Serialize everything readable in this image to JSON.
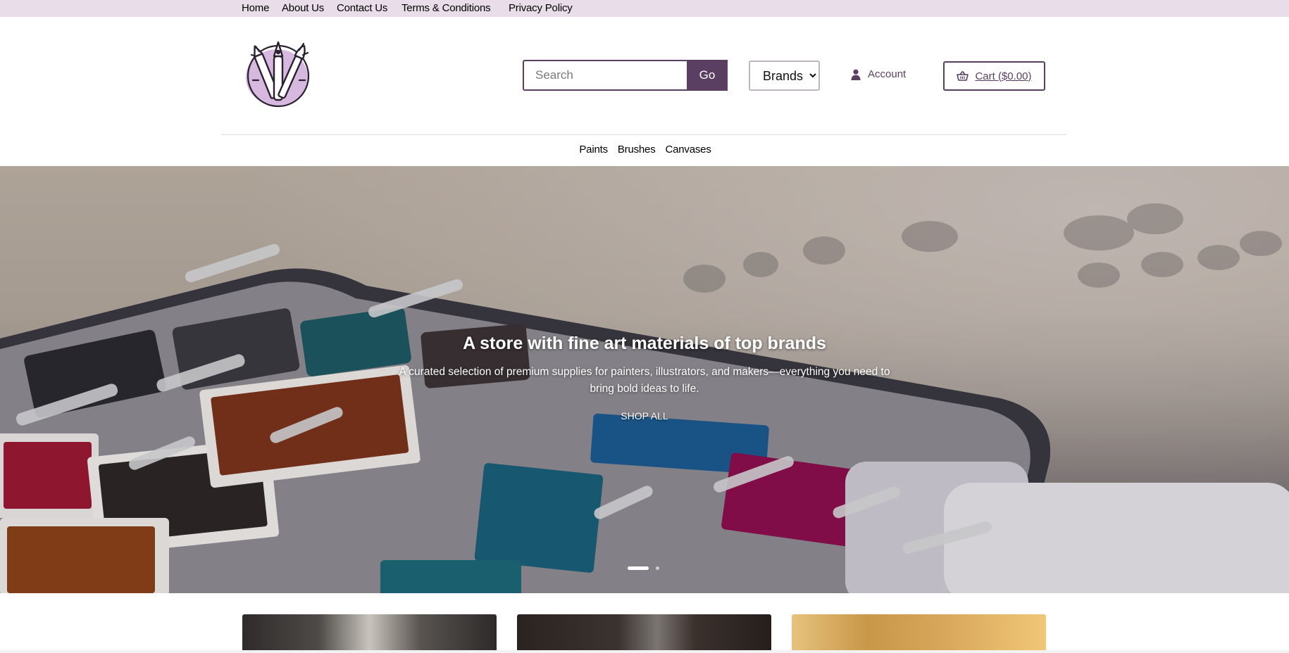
{
  "top_nav": {
    "links": [
      "Home",
      "About Us",
      "Contact Us",
      "Terms & Conditions",
      "Privacy Policy"
    ]
  },
  "header": {
    "logo_icon": "art-supplies-logo-icon",
    "search": {
      "placeholder": "Search",
      "value": "",
      "button_label": "Go"
    },
    "brands_select": {
      "selected": "Brands"
    },
    "account_label": "Account",
    "cart_label": "Cart ($0.00)"
  },
  "category_nav": {
    "items": [
      "Paints",
      "Brushes",
      "Canvases"
    ]
  },
  "hero": {
    "title": "A store with fine art materials of top brands",
    "subtitle": "A curated selection of premium supplies for painters, illustrators, and makers—everything you need to bring bold ideas to life.",
    "cta_label": "SHOP ALL",
    "slides_total": 2,
    "active_slide": 1
  },
  "colors": {
    "brand": "#5b3f63",
    "topbar_bg": "#e8dde8",
    "logo_accent": "#d7b9e0"
  }
}
